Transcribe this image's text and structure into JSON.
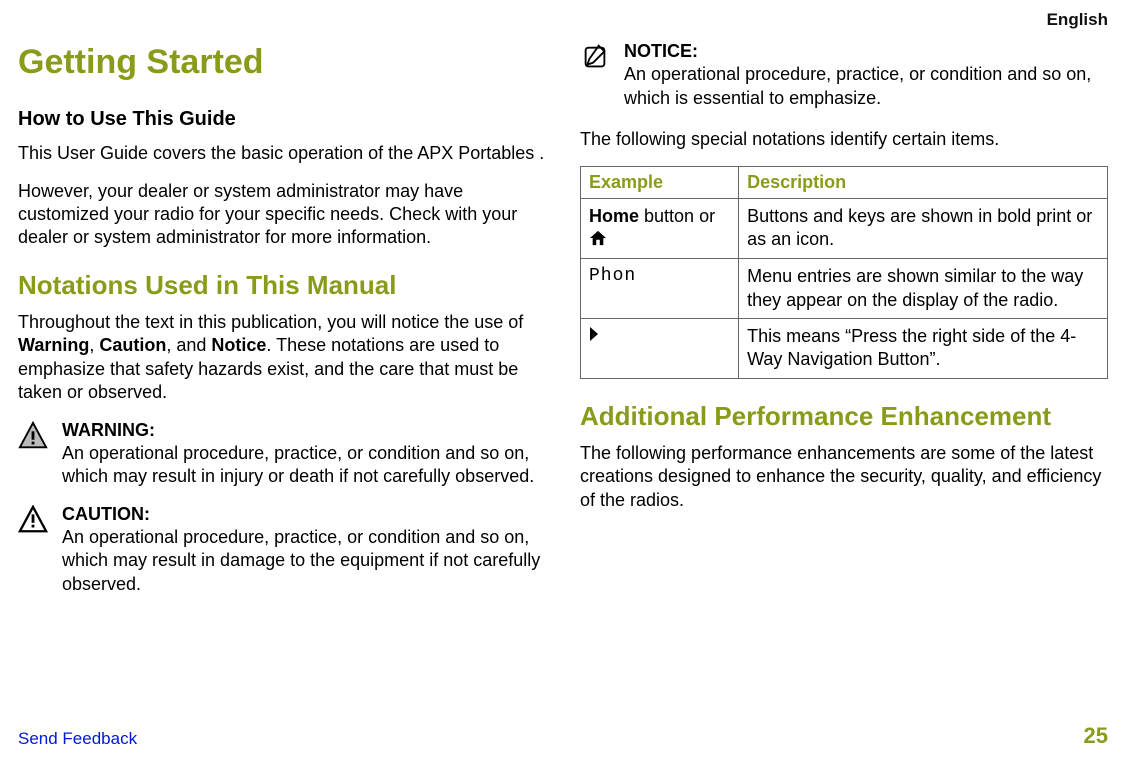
{
  "lang": "English",
  "h1": "Getting Started",
  "h2a": "How to Use This Guide",
  "p1": "This User Guide covers the basic operation of the APX Portables .",
  "p2": "However, your dealer or system administrator may have customized your radio for your specific needs. Check with your dealer or system administrator for more information.",
  "h2b": "Notations Used in This Manual",
  "p3a": "Throughout the text in this publication, you will notice the use of ",
  "p3b": "Warning",
  "p3c": ", ",
  "p3d": "Caution",
  "p3e": ", and ",
  "p3f": "Notice",
  "p3g": ". These notations are used to emphasize that safety hazards exist, and the care that must be taken or observed.",
  "warn_label": "WARNING:",
  "warn_text": "An operational procedure, practice, or condition and so on, which may result in injury or death if not carefully observed.",
  "caut_label": "CAUTION:",
  "caut_text": "An operational procedure, practice, or condition and so on, which may result in damage to the equipment if not carefully observed.",
  "notice_label": "NOTICE:",
  "notice_text": "An operational procedure, practice, or condition and so on, which is essential to emphasize.",
  "p4": "The following special notations identify certain items.",
  "th1": "Example",
  "th2": "Description",
  "row1a_a": "Home",
  "row1a_b": " button or ",
  "row1b": "Buttons and keys are shown in bold print or as an icon.",
  "row2a": "Phon",
  "row2b": "Menu entries are shown similar to the way they appear on the display of the radio.",
  "row3b": "This means “Press the right side of the 4-Way Navigation Button”.",
  "h2c": "Additional Performance Enhancement",
  "p5": "The following performance enhancements are some of the latest creations designed to enhance the security, quality, and efficiency of the radios.",
  "feedback": "Send Feedback",
  "page": "25"
}
